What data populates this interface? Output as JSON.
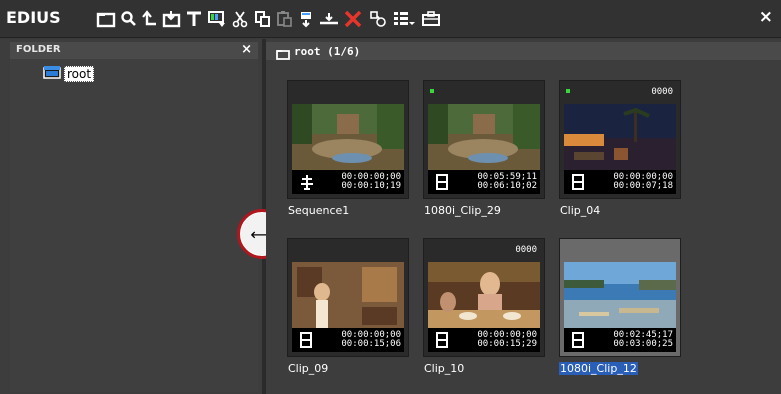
{
  "app": {
    "brand": "EDIUS",
    "close_glyph": "×"
  },
  "toolbar": {
    "icons": [
      "new-folder-icon",
      "search-icon",
      "go-up-icon",
      "add-clip-icon",
      "add-title-icon",
      "color-bar-icon",
      "cut-icon",
      "copy-icon",
      "paste-icon",
      "add-to-timeline-icon",
      "insert-to-timeline-icon",
      "delete-icon",
      "properties-icon",
      "view-mode-icon",
      "view-dropdown-icon",
      "sequence-icon"
    ]
  },
  "folder_panel": {
    "title": "FOLDER",
    "close_glyph": "×",
    "tree": [
      {
        "label": "root",
        "icon": "folder-icon"
      }
    ]
  },
  "bin": {
    "title": "root (1/6)",
    "clips": [
      {
        "name": "Sequence1",
        "type": "sequence-icon",
        "tc_in": "00:00:00;00",
        "tc_out": "00:00:10;19",
        "count": "",
        "marker": false,
        "selected": false,
        "scene": "garden"
      },
      {
        "name": "1080i_Clip_29",
        "type": "film-icon",
        "tc_in": "00:05:59;11",
        "tc_out": "00:06:10;02",
        "count": "",
        "marker": true,
        "selected": false,
        "scene": "garden"
      },
      {
        "name": "Clip_04",
        "type": "film-icon",
        "tc_in": "00:00:00;00",
        "tc_out": "00:00:07;18",
        "count": "0000",
        "marker": true,
        "selected": false,
        "scene": "night"
      },
      {
        "name": "Clip_09",
        "type": "film-icon",
        "tc_in": "00:00:00;00",
        "tc_out": "00:00:15;06",
        "count": "",
        "marker": false,
        "selected": false,
        "scene": "room"
      },
      {
        "name": "Clip_10",
        "type": "film-icon",
        "tc_in": "00:00:00;00",
        "tc_out": "00:00:15;29",
        "count": "0000",
        "marker": false,
        "selected": false,
        "scene": "dinner"
      },
      {
        "name": "1080i_Clip_12",
        "type": "film-icon",
        "tc_in": "00:02:45;17",
        "tc_out": "00:03:00;25",
        "count": "",
        "marker": false,
        "selected": true,
        "scene": "beach"
      }
    ]
  },
  "splitter": {
    "cursor_glyph": "⟷"
  },
  "colors": {
    "accent_marker": "#3bd83b",
    "selection": "#2a5fb8",
    "highlight_ring": "#b0161e"
  }
}
